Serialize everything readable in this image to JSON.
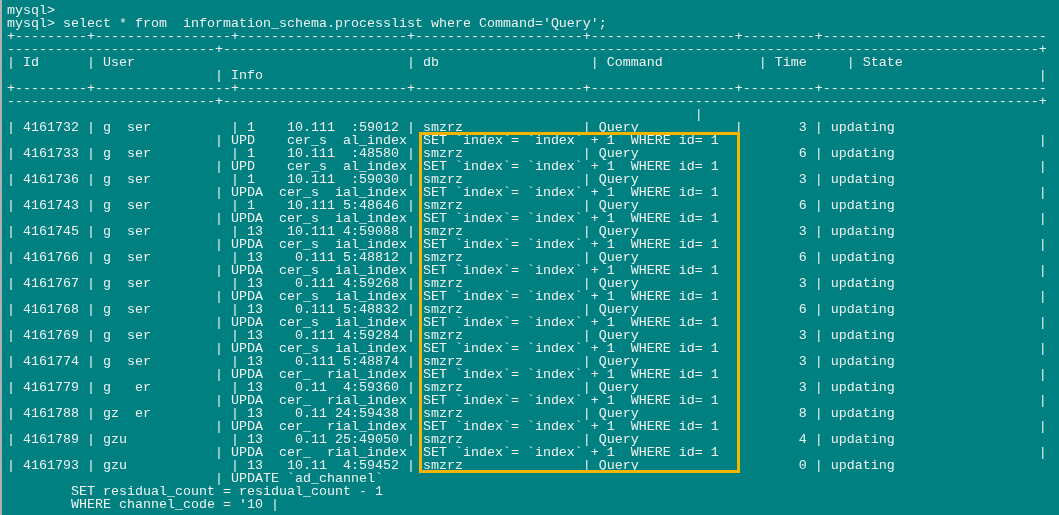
{
  "terminal": {
    "lines": [
      "mysql>",
      "mysql> select * from  information_schema.processlist where Command='Query';",
      "+---------+-----------------+---------------------+---------------------+------------------+---------+----------------------------",
      "--------------------------+------------------------------------------------------------------------------------------------------+",
      "| Id      | User                                  | db                   | Command            | Time     | State",
      "                          | Info                                                                                                 |",
      "+---------+-----------------+---------------------+---------------------+------------------+---------+----------------------------",
      "--------------------------+------------------------------------------------------------------------------------------------------+",
      "                                                                                      |",
      "| 4161732 | g  ser          | 1    10.111  :59012 | smzrz               | Query            |       3 | updating",
      "                          | UPD    cer_s  al_index  SET `index`= `index` + 1  WHERE id= 1                                        |",
      "| 4161733 | g  ser          | 1    10.111  :48580 | smzrz               | Query                    6 | updating",
      "                          | UPD    cer_s  al_index  SET `index`= `index` + 1  WHERE id= 1                                        |",
      "| 4161736 | g  ser          | 1    10.111  :59030 | smzrz               | Query                    3 | updating",
      "                          | UPDA  cer_s  ial_index  SET `index`= `index` + 1  WHERE id= 1                                        |",
      "| 4161743 | g  ser          | 1    10.111 5:48646 | smzrz               | Query                    6 | updating",
      "                          | UPDA  cer_s  ial_index  SET `index`= `index` + 1  WHERE id= 1                                        |",
      "| 4161745 | g  ser          | 13   10.111 4:59088 | smzrz               | Query                    3 | updating",
      "                          | UPDA  cer_s  ial_index  SET `index`= `index` + 1  WHERE id= 1                                        |",
      "| 4161766 | g  ser          | 13    0.111 5:48812 | smzrz               | Query                    6 | updating",
      "                          | UPDA  cer_s  ial_index  SET `index`= `index` + 1  WHERE id= 1                                        |",
      "| 4161767 | g  ser          | 13    0.111 4:59268 | smzrz               | Query                    3 | updating",
      "                          | UPDA  cer_s  ial_index  SET `index`= `index` + 1  WHERE id= 1                                        |",
      "| 4161768 | g  ser          | 13    0.111 5:48832 | smzrz               | Query                    6 | updating",
      "                          | UPDA  cer_s  ial_index  SET `index`= `index` + 1  WHERE id= 1                                        |",
      "| 4161769 | g  ser          | 13    0.111 4:59284 | smzrz               | Query                    3 | updating",
      "                          | UPDA  cer_s  ial_index  SET `index`= `index` + 1  WHERE id= 1                                        |",
      "| 4161774 | g  ser          | 13    0.111 5:48874 | smzrz               | Query                    3 | updating",
      "                          | UPDA  cer_  rial_index  SET `index`= `index` + 1  WHERE id= 1                                        |",
      "| 4161779 | g   er          | 13    0.11  4:59360 | smzrz               | Query                    3 | updating",
      "                          | UPDA  cer_  rial_index  SET `index`= `index` + 1  WHERE id= 1                                        |",
      "| 4161788 | gz  er          | 13    0.11 24:59438 | smzrz               | Query                    8 | updating",
      "                          | UPDA  cer_  rial_index  SET `index`= `index` + 1  WHERE id= 1                                        |",
      "| 4161789 | gzu             | 13    0.11 25:49050 | smzrz               | Query                    4 | updating",
      "                          | UPDA  cer_  rial_index  SET `index`= `index` + 1  WHERE id= 1                                        |",
      "| 4161793 | gzu             | 13   10.11  4:59452 | smzrz               | Query                    0 | updating",
      "                          | UPDATE `ad_channel`",
      "        SET residual_count = residual_count - 1",
      "        WHERE channel_code = '10 |"
    ]
  }
}
